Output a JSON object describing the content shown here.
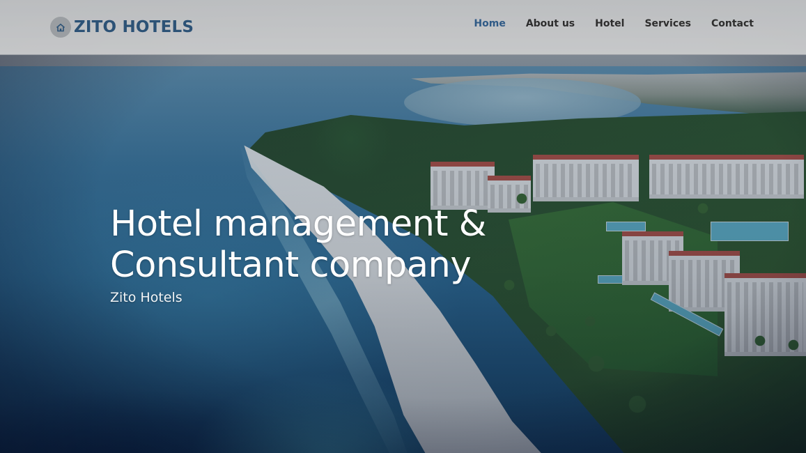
{
  "header": {
    "brand": {
      "icon": "home-icon",
      "name": "ZITO HOTELS"
    },
    "nav": [
      {
        "label": "Home",
        "active": true
      },
      {
        "label": "About us",
        "active": false
      },
      {
        "label": "Hotel",
        "active": false
      },
      {
        "label": "Services",
        "active": false
      },
      {
        "label": "Contact",
        "active": false
      }
    ]
  },
  "hero": {
    "title_line1": "Hotel management &",
    "title_line2": "Consultant company",
    "subtitle": "Zito Hotels"
  },
  "colors": {
    "brand": "#2c5276",
    "nav_active": "#2f5a86",
    "nav_text": "#2d2d2d",
    "hero_text": "#ffffff"
  }
}
